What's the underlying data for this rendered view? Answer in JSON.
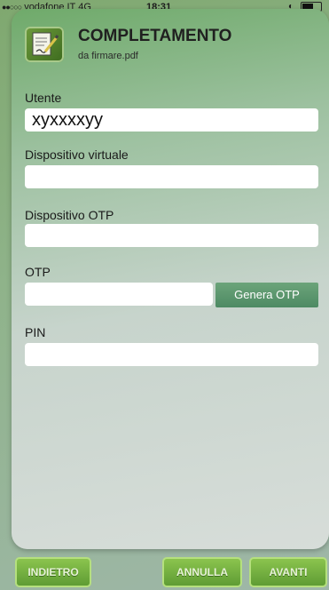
{
  "status_bar": {
    "signal_dots": "●●○○○",
    "carrier": "vodafone IT",
    "network": "4G",
    "time": "18:31"
  },
  "header": {
    "title": "COMPLETAMENTO",
    "subtitle": "da firmare.pdf"
  },
  "form": {
    "utente": {
      "label": "Utente",
      "value": "xyxxxxyy"
    },
    "dispositivo_virtuale": {
      "label": "Dispositivo virtuale",
      "value": ""
    },
    "dispositivo_otp": {
      "label": "Dispositivo OTP",
      "value": ""
    },
    "otp": {
      "label": "OTP",
      "value": "",
      "button": "Genera OTP"
    },
    "pin": {
      "label": "PIN",
      "value": ""
    }
  },
  "footer": {
    "back": "INDIETRO",
    "cancel": "ANNULLA",
    "next": "AVANTI"
  },
  "colors": {
    "accent_green": "#5f9c34",
    "otp_button": "#5a9670"
  }
}
